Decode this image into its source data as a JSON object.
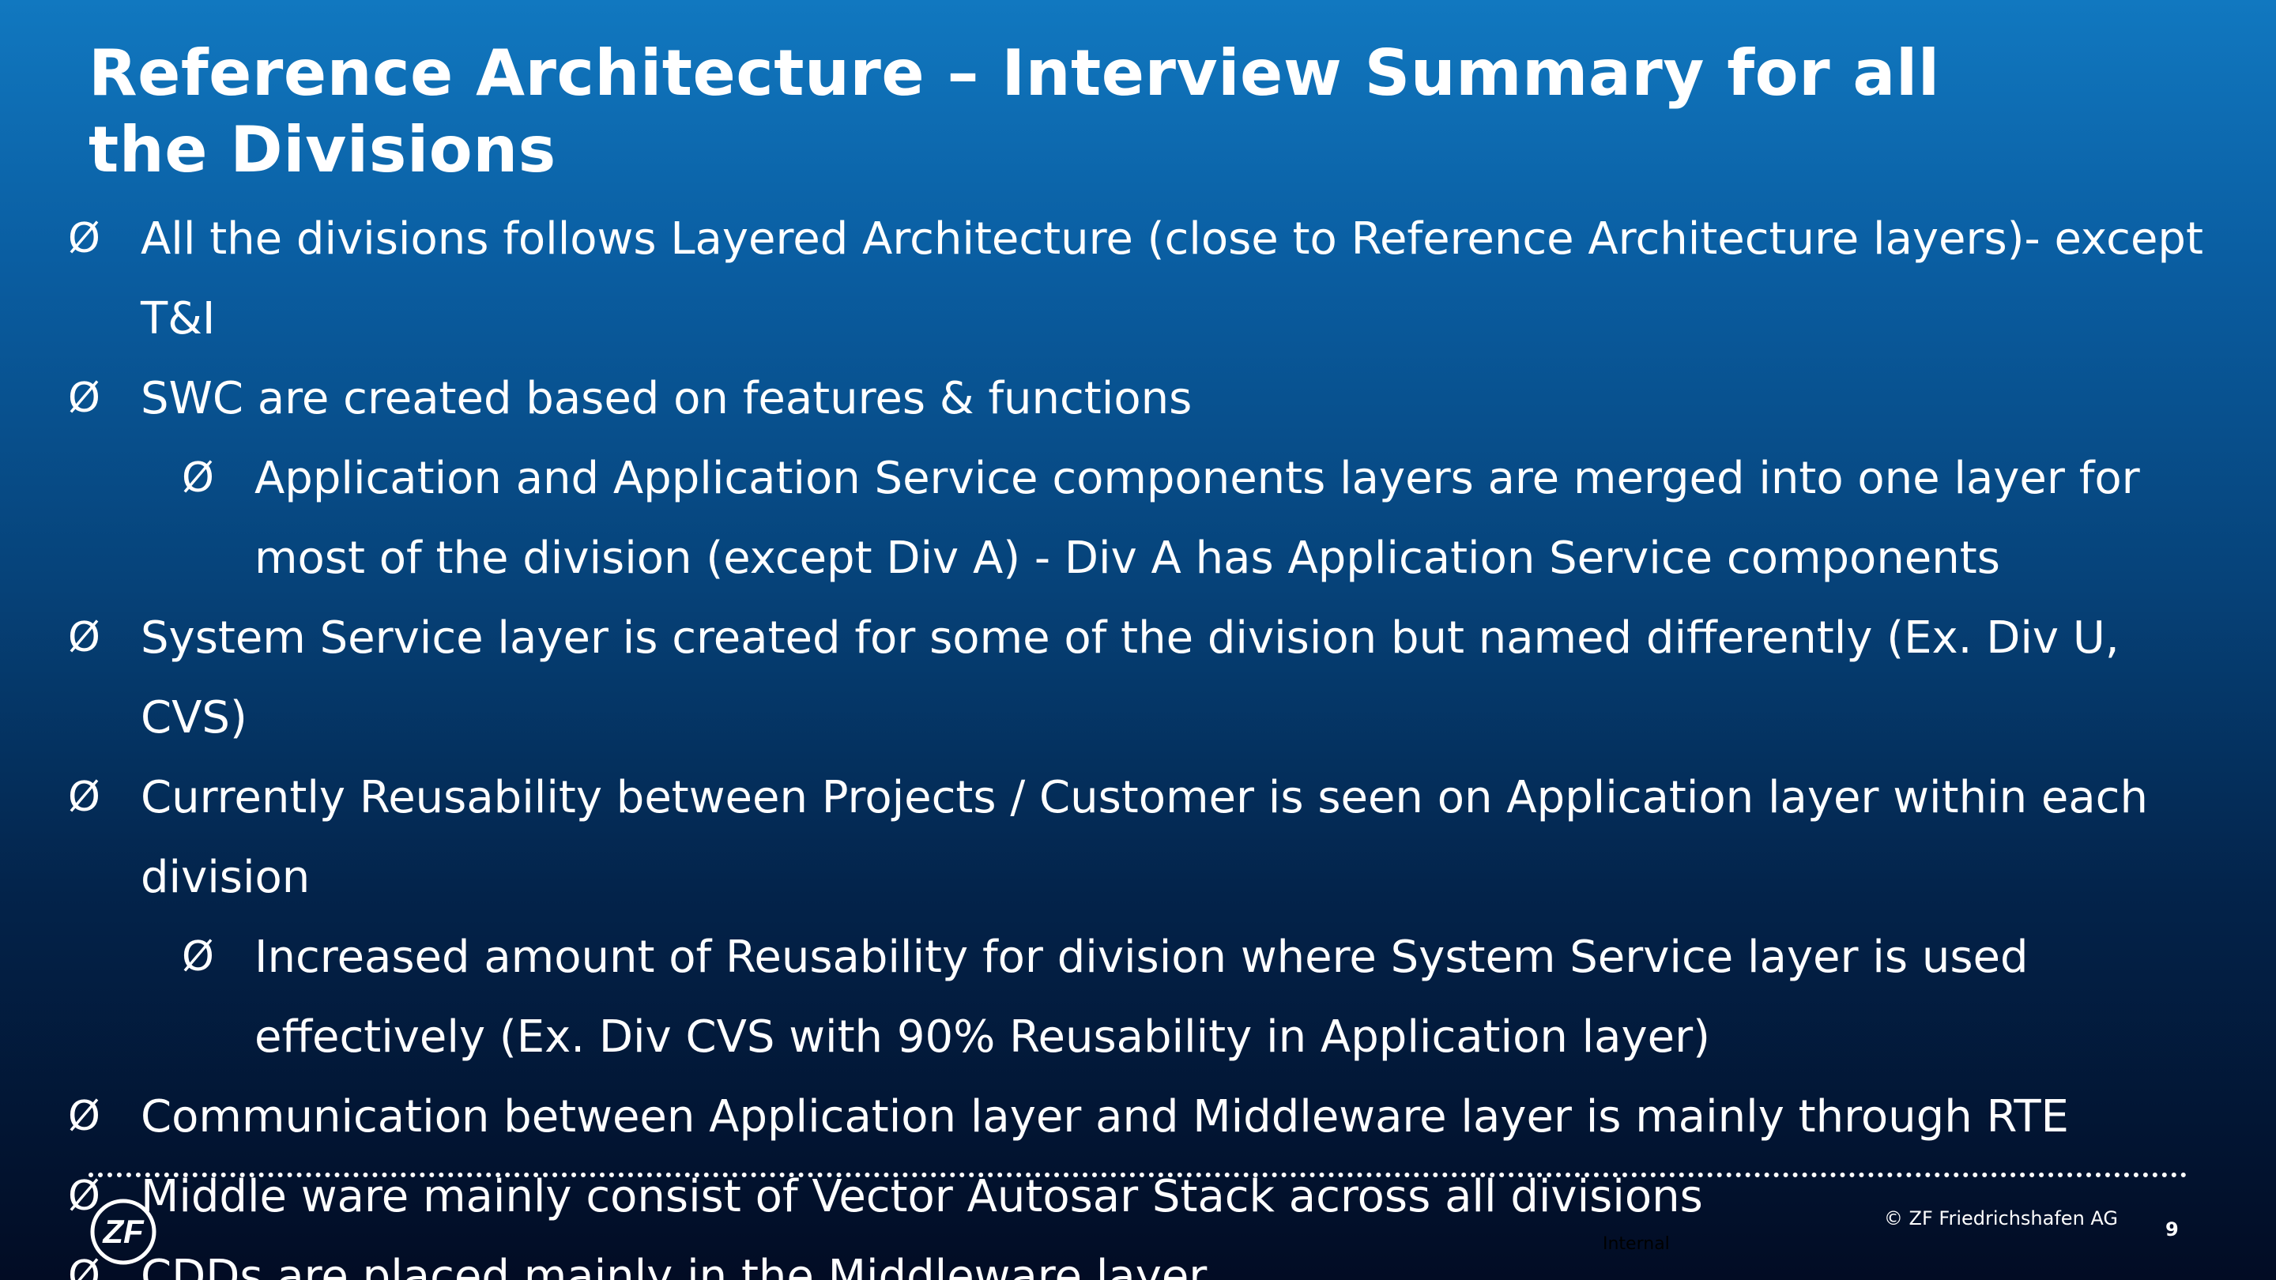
{
  "slide": {
    "title": "Reference Architecture – Interview Summary for all the Divisions",
    "bullet_marker": "Ø",
    "bullets": [
      {
        "level": 1,
        "text": "All the divisions follows Layered Architecture (close to Reference Architecture layers)- except T&I"
      },
      {
        "level": 1,
        "text": "SWC are created based on features & functions"
      },
      {
        "level": 2,
        "text": "Application and Application Service components layers are merged into one layer for most of the division (except Div A) - Div A has Application Service components"
      },
      {
        "level": 1,
        "text": "System Service layer is created for some of the division but named differently (Ex. Div U, CVS)"
      },
      {
        "level": 1,
        "text": "Currently Reusability between Projects / Customer is seen on Application layer within each division"
      },
      {
        "level": 2,
        "text": "Increased amount of Reusability for division where System Service layer is used effectively (Ex. Div CVS with 90% Reusability in Application layer)"
      },
      {
        "level": 1,
        "text": "Communication between Application layer and Middleware layer is mainly through RTE"
      },
      {
        "level": 1,
        "text": "Middle ware mainly consist of Vector Autosar Stack across all divisions"
      },
      {
        "level": 1,
        "text": "CDDs are placed mainly in the Middleware layer"
      }
    ]
  },
  "footer": {
    "logo_text": "ZF",
    "classification": "Internal",
    "copyright": "© ZF Friedrichshafen AG",
    "page_number": "9"
  },
  "colors": {
    "background_top": "#1178c0",
    "background_bottom": "#020c24",
    "text": "#ffffff"
  }
}
